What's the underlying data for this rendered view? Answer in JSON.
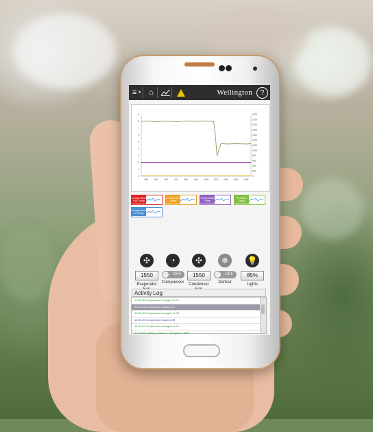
{
  "app": {
    "brand": "Wellington",
    "help": "?",
    "nav_icons": [
      "menu-wifi-icon",
      "home-icon",
      "chart-icon",
      "warning-icon"
    ]
  },
  "chart_data": {
    "type": "line",
    "x_ticks": [
      "880",
      "900",
      "920",
      "940",
      "960",
      "980",
      "1000",
      "1020",
      "1040",
      "1060",
      "1080"
    ],
    "y_left_ticks": [
      "0",
      "1",
      "2",
      "3",
      "4",
      "5",
      "6",
      "7",
      "8",
      "9"
    ],
    "y_right_ticks": [
      "0",
      "200",
      "400",
      "600",
      "800",
      "1000",
      "1200",
      "1400",
      "1600",
      "1800",
      "2000",
      "2200",
      "2400"
    ],
    "xlim": [
      870,
      1090
    ],
    "ylim_left": [
      0,
      9
    ],
    "ylim_right": [
      0,
      2400
    ],
    "series": [
      {
        "color": "#9aa36a",
        "axis": "left",
        "x": [
          870,
          880,
          900,
          920,
          940,
          960,
          980,
          1000,
          1015,
          1018,
          1022,
          1030,
          1040,
          1060,
          1080,
          1090
        ],
        "y": [
          8,
          8.05,
          7.95,
          8.05,
          7.95,
          8.05,
          8,
          8.05,
          8,
          6.5,
          3,
          4.8,
          4.7,
          4.75,
          4.7,
          4.75
        ]
      },
      {
        "color": "#d0208a",
        "axis": "left",
        "x": [
          870,
          1090
        ],
        "y": [
          2,
          2
        ]
      },
      {
        "color": "#7a48b8",
        "axis": "left",
        "x": [
          870,
          1090
        ],
        "y": [
          1.95,
          1.95
        ]
      },
      {
        "color": "#f0c020",
        "axis": "left",
        "x": [
          870,
          1090
        ],
        "y": [
          0.08,
          0.08
        ]
      }
    ]
  },
  "legend": [
    {
      "label": "Compressor Out Temp",
      "color": "#e02020",
      "border": "#e02020"
    },
    {
      "label": "Condenser Temp",
      "color": "#f0a020",
      "border": "#e8a020"
    },
    {
      "label": "Evaporator Temp",
      "color": "#9060c0",
      "border": "#9060c0"
    },
    {
      "label": "Product Temp",
      "color": "#80c040",
      "border": "#80c040"
    },
    {
      "label": "Compressor In Temp",
      "color": "#4a90d9",
      "border": "#4a90d9"
    }
  ],
  "controls": [
    {
      "name": "Evaporator Fan",
      "icon": "fan-icon",
      "kind": "value",
      "value": "1550"
    },
    {
      "name": "Compressor",
      "icon": "compressor-icon",
      "kind": "toggle",
      "value": "OFF"
    },
    {
      "name": "Condenser Fan",
      "icon": "fan-icon",
      "kind": "value",
      "value": "1550"
    },
    {
      "name": "Defrost",
      "icon": "defrost-icon",
      "kind": "toggle",
      "value": "OFF"
    },
    {
      "name": "Lights",
      "icon": "bulb-icon",
      "kind": "value",
      "value": "85%"
    }
  ],
  "activity_log": {
    "title": "Activity Log",
    "rows": [
      {
        "text": "11:00:16 Compressor  changed to On",
        "color": "#2a9a2a",
        "selected": false
      },
      {
        "text": "11:00:14 Compressor  request On",
        "color": "#3a3ab0",
        "selected": true
      },
      {
        "text": "11:00:12 Compressor  changed to Off",
        "color": "#2a9a2a",
        "selected": false
      },
      {
        "text": "11:00:10 Compressor  request Off",
        "color": "#3a3ab0",
        "selected": false
      },
      {
        "text": "11:00:07 Compressor  changed to On",
        "color": "#2a9a2a",
        "selected": false
      },
      {
        "text": "11:00:06 Lighting channel 1 changed to 1550",
        "color": "#2a9a2a",
        "selected": false
      }
    ]
  }
}
